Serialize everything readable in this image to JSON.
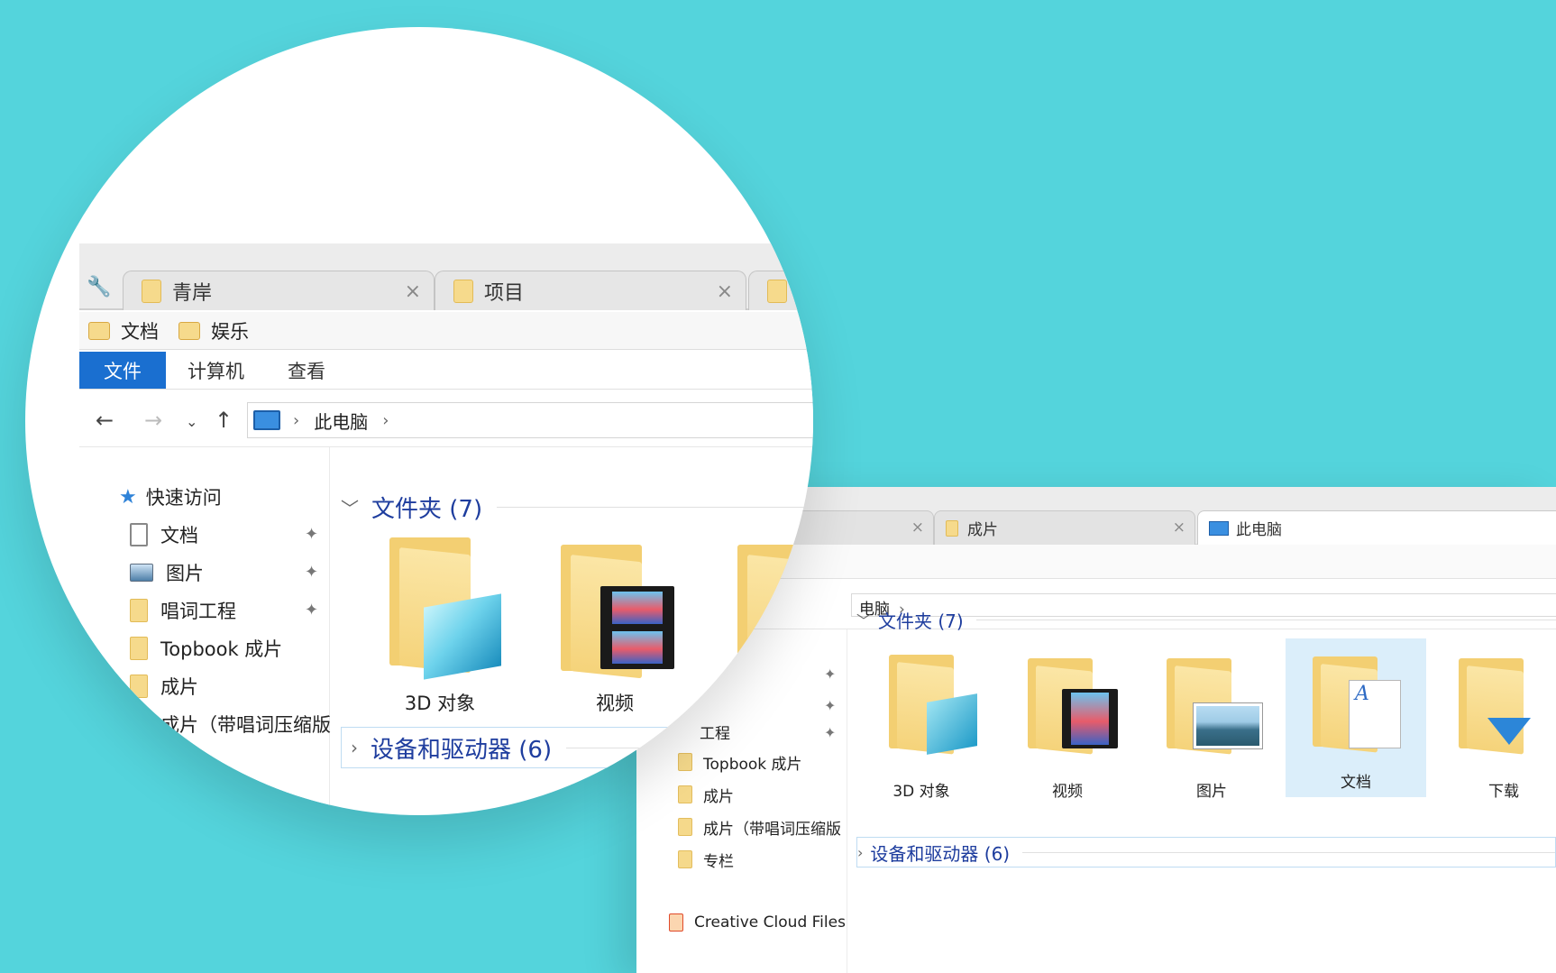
{
  "lens": {
    "tabs": [
      {
        "label": "青岸"
      },
      {
        "label": "项目"
      }
    ],
    "favorites": [
      "文档",
      "娱乐"
    ],
    "ribbon": [
      "文件",
      "计算机",
      "查看"
    ],
    "address": {
      "root": "此电脑"
    },
    "nav": {
      "quick_access": "快速访问",
      "items": [
        "文档",
        "图片",
        "唱词工程",
        "Topbook 成片",
        "成片",
        "成片（带唱词压缩版"
      ]
    },
    "folders_group": "文件夹 (7)",
    "folders": [
      "3D 对象",
      "视频"
    ],
    "devices_group": "设备和驱动器 (6)"
  },
  "bg": {
    "tabs": [
      {
        "label": "项目"
      },
      {
        "label": "成片"
      },
      {
        "label": "此电脑"
      }
    ],
    "address_tail": "电脑",
    "nav_items": [
      "工程",
      "Topbook 成片",
      "成片",
      "成片（带唱词压缩版",
      "专栏",
      "Creative Cloud Files"
    ],
    "folders_group": "文件夹 (7)",
    "folders": [
      "3D 对象",
      "视频",
      "图片",
      "文档",
      "下载"
    ],
    "devices_group": "设备和驱动器 (6)"
  }
}
